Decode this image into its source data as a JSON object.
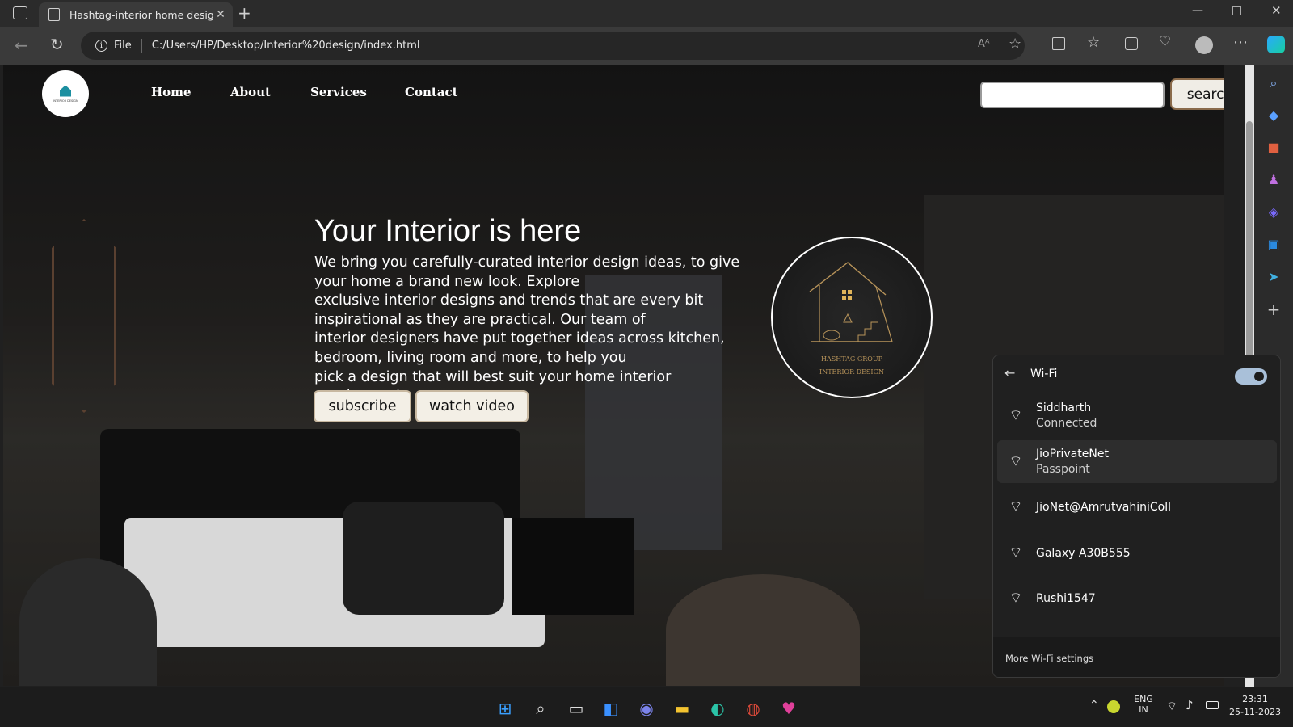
{
  "browser": {
    "tab_title": "Hashtag-interior home designing",
    "tab_close": "✕",
    "new_tab": "+",
    "protocol_label": "File",
    "url": "C:/Users/HP/Desktop/Interior%20design/index.html"
  },
  "site": {
    "logo_text": "INTERIOR DESIGN",
    "nav": [
      "Home",
      "About",
      "Services",
      "Contact"
    ],
    "search_placeholder": "",
    "search_button": "search",
    "hero_title": "Your Interior is here",
    "hero_lines": [
      "We bring you carefully-curated interior design ideas, to give your home a brand new look. Explore",
      "exclusive interior designs and trends that are every bit inspirational as they are practical. Our team of",
      "interior designers have put together ideas across kitchen, bedroom, living room and more, to help you",
      "pick a design that will best suit your home interior requirements"
    ],
    "subscribe_button": "subscribe",
    "watch_button": "watch video",
    "badge_line1": "HASHTAG GROUP",
    "badge_line2": "INTERIOR DESIGN"
  },
  "wifi_panel": {
    "title": "Wi-Fi",
    "toggle_on": true,
    "networks": [
      {
        "name": "Siddharth",
        "status": "Connected",
        "secured": true
      },
      {
        "name": "JioPrivateNet",
        "status": "Passpoint",
        "secured": true
      },
      {
        "name": "JioNet@AmrutvahiniColl",
        "status": "",
        "secured": false
      },
      {
        "name": "Galaxy A30B555",
        "status": "",
        "secured": true
      },
      {
        "name": "Rushi1547",
        "status": "",
        "secured": true
      }
    ],
    "more_settings": "More Wi-Fi settings"
  },
  "taskbar": {
    "lang_top": "ENG",
    "lang_bottom": "IN",
    "time": "23:31",
    "date": "25-11-2023"
  },
  "colors": {
    "accent": "#a9c0d9",
    "button_bg": "#f3efe6",
    "gold": "#b8945a"
  }
}
